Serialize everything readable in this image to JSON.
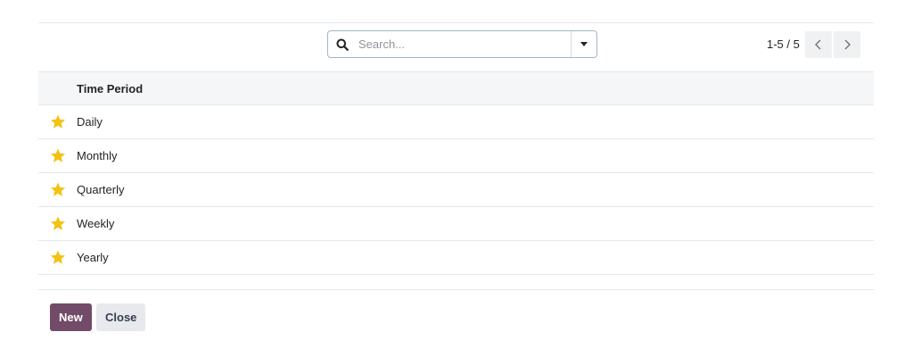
{
  "search": {
    "placeholder": "Search...",
    "icon": "search-icon",
    "toggle_icon": "caret-down-icon"
  },
  "pager": {
    "value": "1-5 / 5",
    "prev_icon": "chevron-left-icon",
    "next_icon": "chevron-right-icon"
  },
  "list": {
    "column_header": "Time Period",
    "rows": [
      {
        "label": "Daily",
        "icon": "star-icon"
      },
      {
        "label": "Monthly",
        "icon": "star-icon"
      },
      {
        "label": "Quarterly",
        "icon": "star-icon"
      },
      {
        "label": "Weekly",
        "icon": "star-icon"
      },
      {
        "label": "Yearly",
        "icon": "star-icon"
      }
    ]
  },
  "footer": {
    "new_label": "New",
    "close_label": "Close"
  },
  "colors": {
    "primary": "#714b67",
    "star": "#f3c212",
    "secondary_button": "#e7e9ed"
  }
}
